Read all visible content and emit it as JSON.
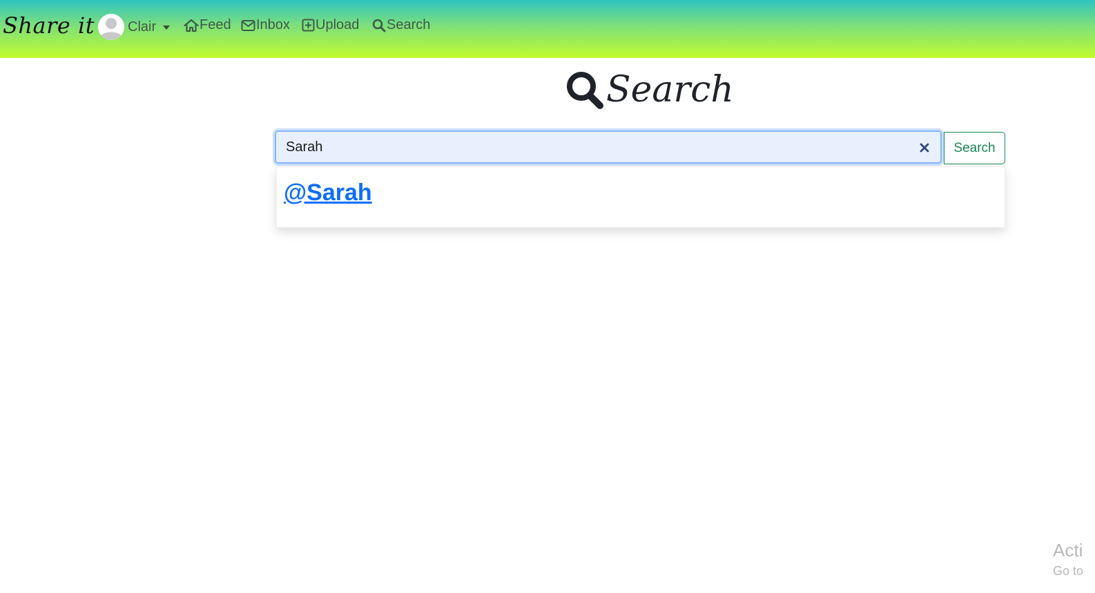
{
  "navbar": {
    "brand": "Share it",
    "user": {
      "name": "Clair"
    },
    "items": [
      {
        "label": "Feed",
        "icon": "home-icon"
      },
      {
        "label": "Inbox",
        "icon": "envelope-icon"
      },
      {
        "label": "Upload",
        "icon": "plus-square-icon"
      },
      {
        "label": "Search",
        "icon": "search-icon"
      }
    ],
    "colors": {
      "gradient_top": "#2ec4c0",
      "gradient_bottom": "#c2fb2c"
    }
  },
  "page": {
    "title": "Search",
    "title_icon": "magnifier-icon"
  },
  "search": {
    "value": "Sarah",
    "button_label": "Search",
    "clear_icon": "close-icon"
  },
  "results": [
    {
      "label": "@Sarah"
    }
  ],
  "watermark": {
    "line1": "Acti",
    "line2": "Go to"
  }
}
